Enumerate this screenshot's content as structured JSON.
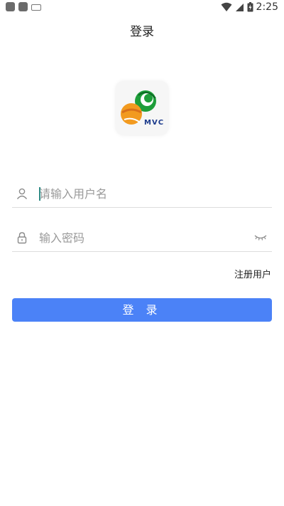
{
  "status_bar": {
    "time": "2:25",
    "icons": [
      "app-notification-icon",
      "app-notification-icon",
      "keyboard-icon",
      "wifi-icon",
      "signal-icon",
      "battery-icon"
    ]
  },
  "header": {
    "title": "登录"
  },
  "logo": {
    "text": "MVC"
  },
  "form": {
    "username_placeholder": "请输入用户名",
    "username_value": "",
    "password_placeholder": "输入密码",
    "password_value": "",
    "register_label": "注册用户",
    "login_label": "登 录"
  },
  "colors": {
    "accent": "#4b82f7",
    "divider": "#dddddd",
    "caret": "#2e8b85"
  }
}
